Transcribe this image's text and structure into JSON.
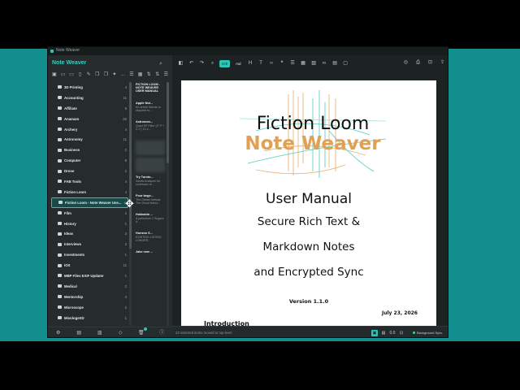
{
  "window": {
    "title": "Note Weaver"
  },
  "sidebar": {
    "app_name": "Note Weaver",
    "folders": [
      {
        "name": "3D Printing",
        "count": "4"
      },
      {
        "name": "Accounting",
        "count": "11"
      },
      {
        "name": "Affiliate",
        "count": "5"
      },
      {
        "name": "Anamam",
        "count": "22"
      },
      {
        "name": "Archery",
        "count": "4"
      },
      {
        "name": "Astronomy",
        "count": "11"
      },
      {
        "name": "Business",
        "count": "2"
      },
      {
        "name": "Computer",
        "count": "8"
      },
      {
        "name": "Drone",
        "count": "2"
      },
      {
        "name": "FAB Tools",
        "count": "4"
      },
      {
        "name": "Fiction Loom",
        "count": "4"
      },
      {
        "name": "Fiction Loom - Note Weaver Use...",
        "count": "1"
      },
      {
        "name": "Film",
        "count": "2"
      },
      {
        "name": "History",
        "count": "1"
      },
      {
        "name": "Ideas",
        "count": "3"
      },
      {
        "name": "Interviews",
        "count": "2"
      },
      {
        "name": "Investments",
        "count": "1"
      },
      {
        "name": "IOS",
        "count": "11"
      },
      {
        "name": "MBP Files EXIF Updater",
        "count": "1"
      },
      {
        "name": "Medical",
        "count": "2"
      },
      {
        "name": "Mentorship",
        "count": "4"
      },
      {
        "name": "Microscope",
        "count": "2"
      },
      {
        "name": "MixologeXD",
        "count": "1"
      }
    ],
    "notes": [
      {
        "title": "FICTION LOOM - NOTE WEAVER USER MANUAL",
        "excerpt": ""
      },
      {
        "title": "Apple Not...",
        "excerpt": "An article license is required to..."
      },
      {
        "title": "Astronom...",
        "excerpt": "Quad EP Filter (2\" P + 0.1\") 12-2..."
      },
      {
        "title": "",
        "excerpt": "",
        "blurred": true
      },
      {
        "title": "",
        "excerpt": "",
        "blurred": true
      },
      {
        "title": "Try Turnin...",
        "excerpt": "Intuitiv Analyzer for codebase re..."
      },
      {
        "title": "Four large...",
        "excerpt": "The Dream Nebula The Ghost Nebul..."
      },
      {
        "title": "Hokkaido ...",
        "excerpt": "A palindrom 2 Sugars it..."
      },
      {
        "title": "Horizon S...",
        "excerpt": "EXISTING LISTING LONGER..."
      },
      {
        "title": "Jake new ...",
        "excerpt": ""
      }
    ]
  },
  "toolbar": {
    "rich_label": "rich",
    "md_label": "md"
  },
  "document": {
    "logo_line1": "Fiction Loom",
    "logo_line2": "Note Weaver",
    "title": "User Manual",
    "line1": "Secure Rich Text &",
    "line2": "Markdown Notes",
    "line3": "and Encrypted Sync",
    "version": "Version 1.1.0",
    "date": "July 23, 2026",
    "section": "Introduction"
  },
  "status": {
    "message": "23 selected items moved to top level",
    "sync_label": "Background Sync",
    "zoom_label": "0.0"
  },
  "colors": {
    "accent": "#2ec4b6",
    "logo_line1": "#111111",
    "logo_line2": "#e2a052"
  }
}
